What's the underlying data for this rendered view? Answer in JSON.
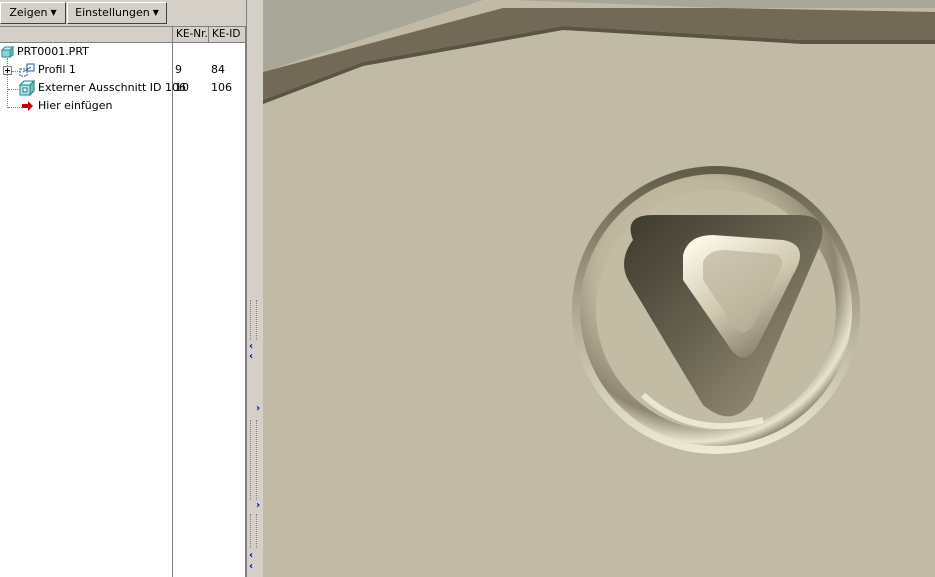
{
  "toolbar": {
    "show_label": "Zeigen",
    "settings_label": "Einstellungen"
  },
  "columns": {
    "feature_no": "KE-Nr.",
    "feature_id": "KE-ID"
  },
  "tree": {
    "root_label": "PRT0001.PRT",
    "items": [
      {
        "label": "Profil 1",
        "feature_no": "9",
        "feature_id": "84",
        "icon": "sketch-profile-icon"
      },
      {
        "label": "Externer Ausschnitt ID 106",
        "feature_no": "10",
        "feature_id": "106",
        "icon": "cut-feature-icon"
      },
      {
        "label": "Hier einfügen",
        "icon": "insert-here-arrow-icon"
      }
    ]
  },
  "colors": {
    "viewport_background": "#c1baa4",
    "panel": "#d4d0c8",
    "insert_arrow": "#cc0000",
    "splitter_arrow": "#0000c0"
  }
}
